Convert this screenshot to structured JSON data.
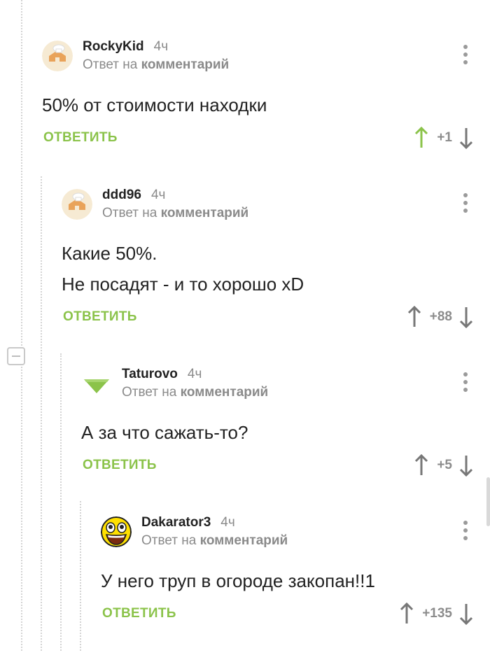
{
  "comments": [
    {
      "author": "RockyKid",
      "time": "4ч",
      "reply_prefix": "Ответ на",
      "reply_target": "комментарий",
      "text_lines": [
        "50% от стоимости находки"
      ],
      "reply_label": "ОТВЕТИТЬ",
      "score": "+1",
      "upvoted": true,
      "avatar": "chef-hat-house-avatar"
    },
    {
      "author": "ddd96",
      "time": "4ч",
      "reply_prefix": "Ответ на",
      "reply_target": "комментарий",
      "text_lines": [
        "Какие 50%.",
        "Не посадят - и то хорошо xD"
      ],
      "reply_label": "ОТВЕТИТЬ",
      "score": "+88",
      "upvoted": false,
      "avatar": "chef-hat-house-avatar"
    },
    {
      "author": "Taturovo",
      "time": "4ч",
      "reply_prefix": "Ответ на",
      "reply_target": "комментарий",
      "text_lines": [
        "А за что сажать-то?"
      ],
      "reply_label": "ОТВЕТИТЬ",
      "score": "+5",
      "upvoted": false,
      "avatar": "green-triangle-avatar"
    },
    {
      "author": "Dakarator3",
      "time": "4ч",
      "reply_prefix": "Ответ на",
      "reply_target": "комментарий",
      "text_lines": [
        "У него труп в огороде закопан!!1"
      ],
      "reply_label": "ОТВЕТИТЬ",
      "score": "+135",
      "upvoted": false,
      "avatar": "awesome-face-avatar"
    }
  ],
  "colors": {
    "accent_green": "#8bc34a",
    "muted_gray": "#8a8a8a",
    "text": "#222222"
  },
  "icons": [
    "upvote-arrow-icon",
    "downvote-arrow-icon",
    "more-options-icon",
    "collapse-thread-icon"
  ]
}
